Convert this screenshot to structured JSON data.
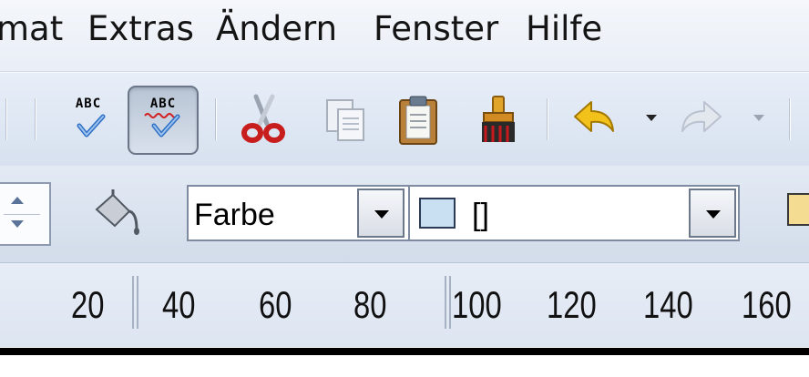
{
  "menubar": {
    "items": [
      "mat",
      "Extras",
      "Ändern",
      "Fenster",
      "Hilfe"
    ]
  },
  "toolbar": {
    "spellcheck_abc": "ABC",
    "autospell_abc": "ABC"
  },
  "formatbar": {
    "fill_style_value": "Farbe",
    "fill_color_value": "[]",
    "fill_color_hex": "#c8e0f2"
  },
  "ruler": {
    "labels": [
      "20",
      "40",
      "60",
      "80",
      "100",
      "120",
      "140",
      "160"
    ]
  }
}
